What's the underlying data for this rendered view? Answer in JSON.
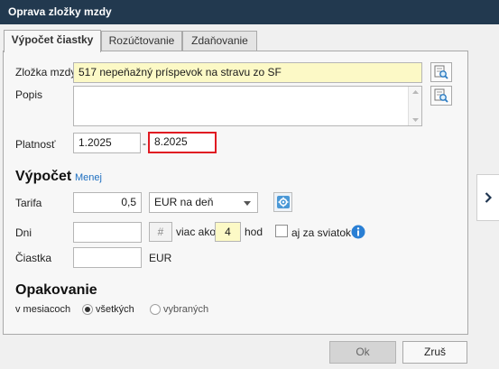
{
  "window": {
    "title": "Oprava zložky mzdy"
  },
  "tabs": [
    {
      "label": "Výpočet čiastky"
    },
    {
      "label": "Rozúčtovanie"
    },
    {
      "label": "Zdaňovanie"
    }
  ],
  "form": {
    "zlozka": {
      "label": "Zložka mzdy",
      "value": "517  nepeňažný príspevok na stravu zo SF"
    },
    "popis": {
      "label": "Popis",
      "value": ""
    },
    "platnost": {
      "label": "Platnosť",
      "from": "1.2025",
      "separator": "-",
      "to": "8.2025"
    }
  },
  "vypocet": {
    "title": "Výpočet",
    "less_link": "Menej",
    "tarifa": {
      "label": "Tarifa",
      "value": "0,5",
      "unit_select": "EUR na deň"
    },
    "dni": {
      "label": "Dni",
      "value": "",
      "hash_symbol": "#",
      "more_than_label": "viac ako",
      "hours_value": "4",
      "hours_unit": "hod",
      "holiday_label": "aj za sviatok"
    },
    "ciastka": {
      "label": "Čiastka",
      "value": "",
      "currency": "EUR"
    }
  },
  "opakovanie": {
    "title": "Opakovanie",
    "label": "v mesiacoch",
    "options": [
      {
        "label": "všetkých",
        "selected": true
      },
      {
        "label": "vybraných",
        "selected": false
      }
    ]
  },
  "footer": {
    "ok_label": "Ok",
    "cancel_label": "Zruš"
  },
  "side": {
    "expand_icon": "chevron-right-icon"
  }
}
